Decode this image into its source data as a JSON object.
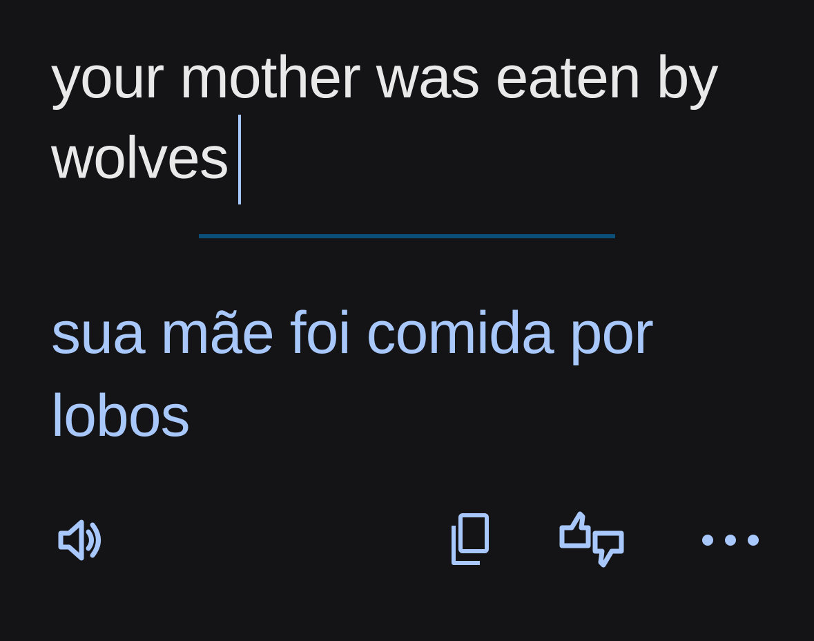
{
  "source": {
    "text": "your mother was eaten by wolves"
  },
  "translation": {
    "text": "sua mãe foi comida por lobos"
  },
  "toolbar": {
    "listen_icon": "volume-icon",
    "copy_icon": "copy-icon",
    "rate_icon": "thumbs-up-down-icon",
    "more_icon": "more-horizontal-icon"
  },
  "colors": {
    "background": "#141416",
    "source_text": "#e9e9e9",
    "translation_text": "#a8c7fa",
    "caret": "#a8c7fa",
    "divider": "#0b4f78",
    "icon": "#a8c7fa"
  }
}
